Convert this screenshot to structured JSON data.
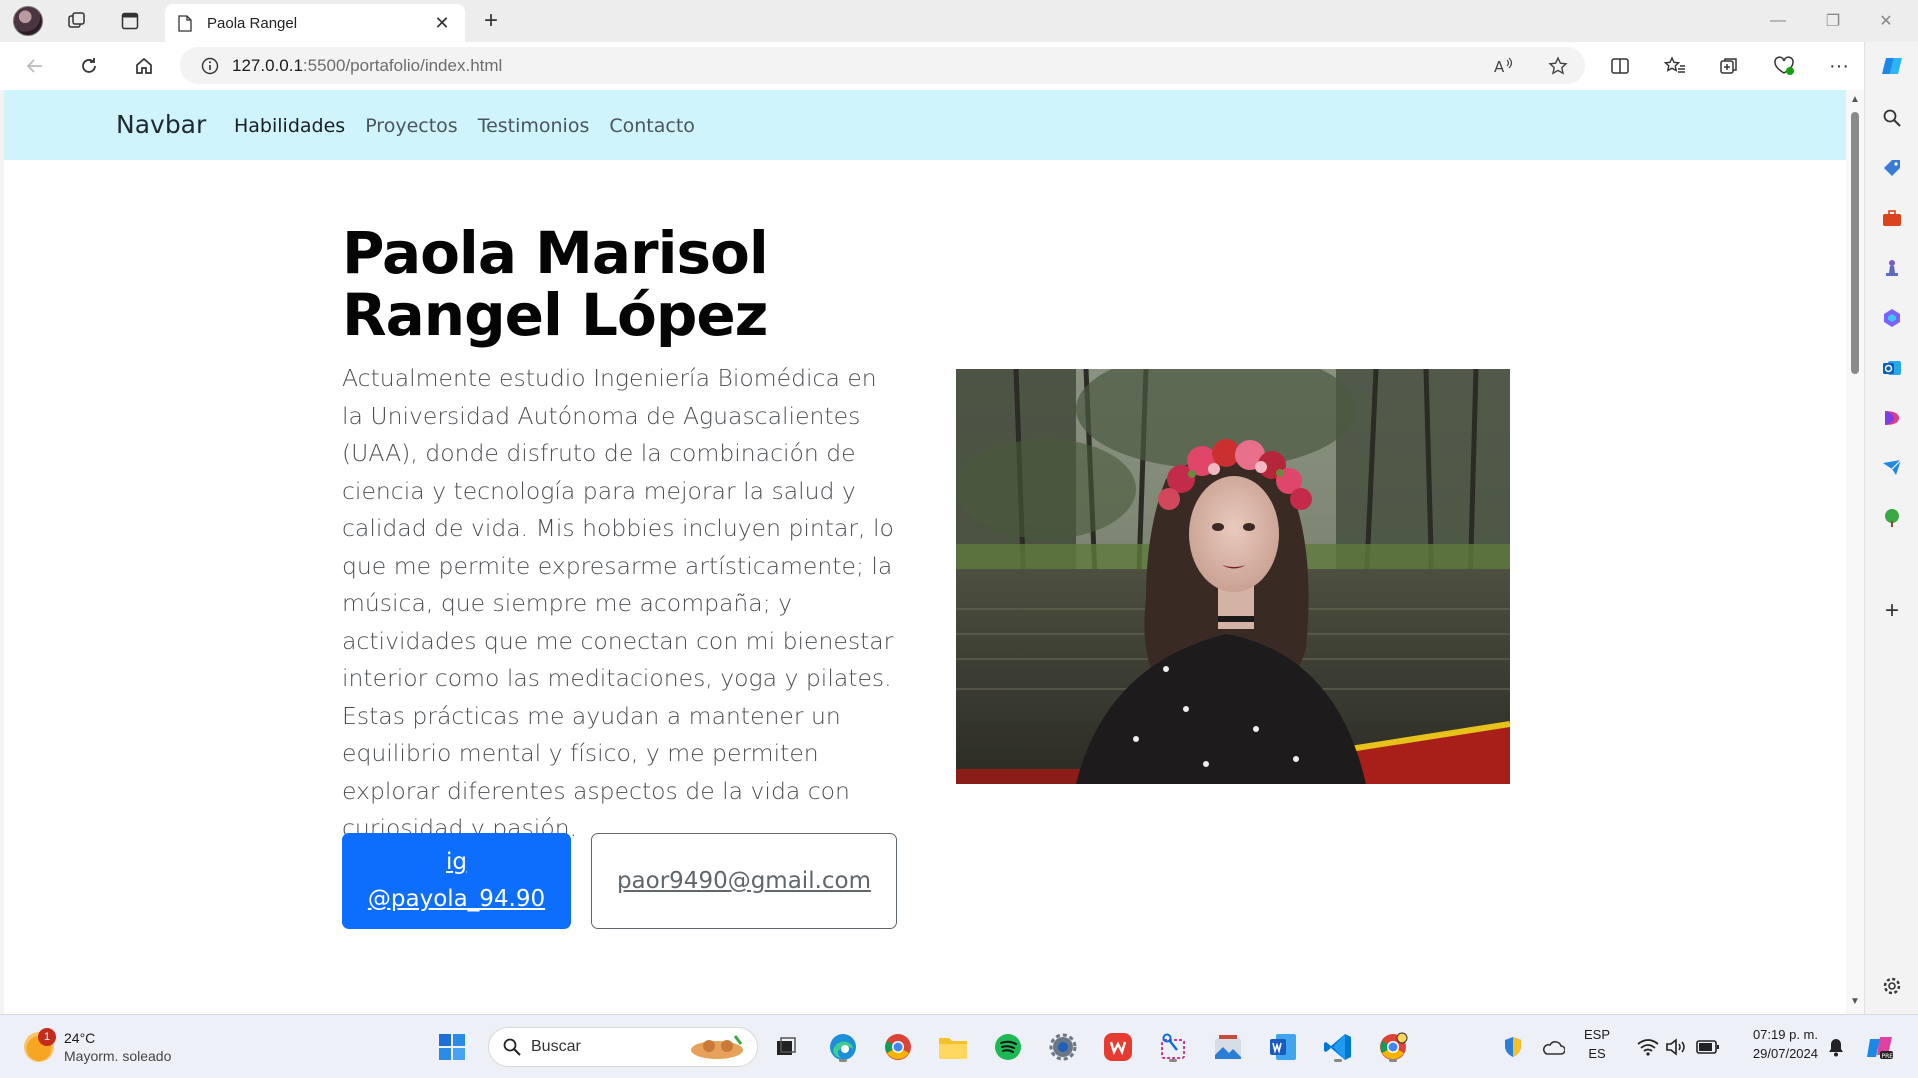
{
  "browser": {
    "tab_title": "Paola Rangel",
    "url_host": "127.0.0.1",
    "url_rest": ":5500/portafolio/index.html"
  },
  "navbar": {
    "brand": "Navbar",
    "links": [
      "Habilidades",
      "Proyectos",
      "Testimonios",
      "Contacto"
    ]
  },
  "hero": {
    "name_line1": "Paola Marisol",
    "name_line2": "Rangel López",
    "bio": "Actualmente estudio Ingeniería Biomédica en la Universidad Autónoma de Aguascalientes (UAA), donde disfruto de la combinación de ciencia y tecnología para mejorar la salud y calidad de vida. Mis hobbies incluyen pintar, lo que me permite expresarme artísticamente; la música, que siempre me acompaña; y actividades que me conectan con mi bienestar interior como las meditaciones, yoga y pilates. Estas prácticas me ayudan a mantener un equilibrio mental y físico, y me permiten explorar diferentes aspectos de la vida con curiosidad y pasión.",
    "ig_line1": "ig",
    "ig_line2": "@payola_94.90",
    "email": "paor9490@gmail.com"
  },
  "taskbar": {
    "temp": "24°C",
    "weather": "Mayorm. soleado",
    "weather_badge": "1",
    "search_placeholder": "Buscar",
    "lang_1": "ESP",
    "lang_2": "ES",
    "time": "07:19 p. m.",
    "date": "29/07/2024"
  },
  "colors": {
    "navbar_bg": "#cff4fc",
    "primary_button": "#0d6efd",
    "secondary_border": "#5f666c"
  }
}
